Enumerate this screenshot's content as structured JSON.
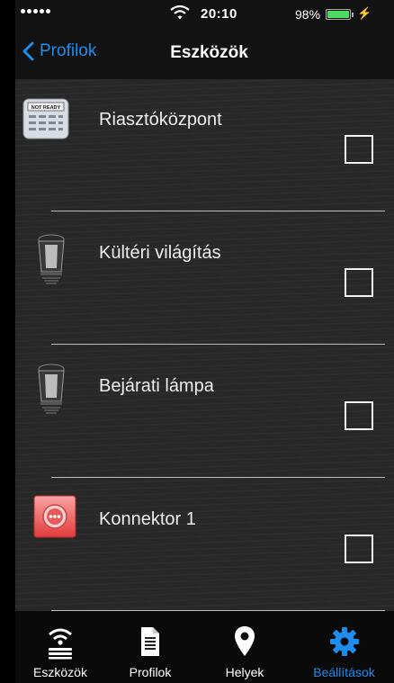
{
  "status_bar": {
    "time": "20:10",
    "battery": "98%",
    "battery_level": 0.98,
    "battery_color": "#4cd964"
  },
  "nav": {
    "back_label": "Profilok",
    "title": "Eszközök",
    "accent_color": "#1e8df0"
  },
  "devices": [
    {
      "label": "Riasztóközpont",
      "icon": "alarm-keypad-icon",
      "icon_text": "NOT READY",
      "checked": false
    },
    {
      "label": "Kültéri világítás",
      "icon": "outdoor-lamp-icon",
      "checked": false
    },
    {
      "label": "Bejárati lámpa",
      "icon": "outdoor-lamp-icon",
      "checked": false
    },
    {
      "label": "Konnektor 1",
      "icon": "power-socket-icon",
      "checked": false
    }
  ],
  "tabs": [
    {
      "label": "Eszközök",
      "icon": "wifi-devices-icon",
      "active": false
    },
    {
      "label": "Profilok",
      "icon": "document-icon",
      "active": false
    },
    {
      "label": "Helyek",
      "icon": "location-pin-icon",
      "active": false
    },
    {
      "label": "Beállítások",
      "icon": "gear-icon",
      "active": true
    }
  ]
}
